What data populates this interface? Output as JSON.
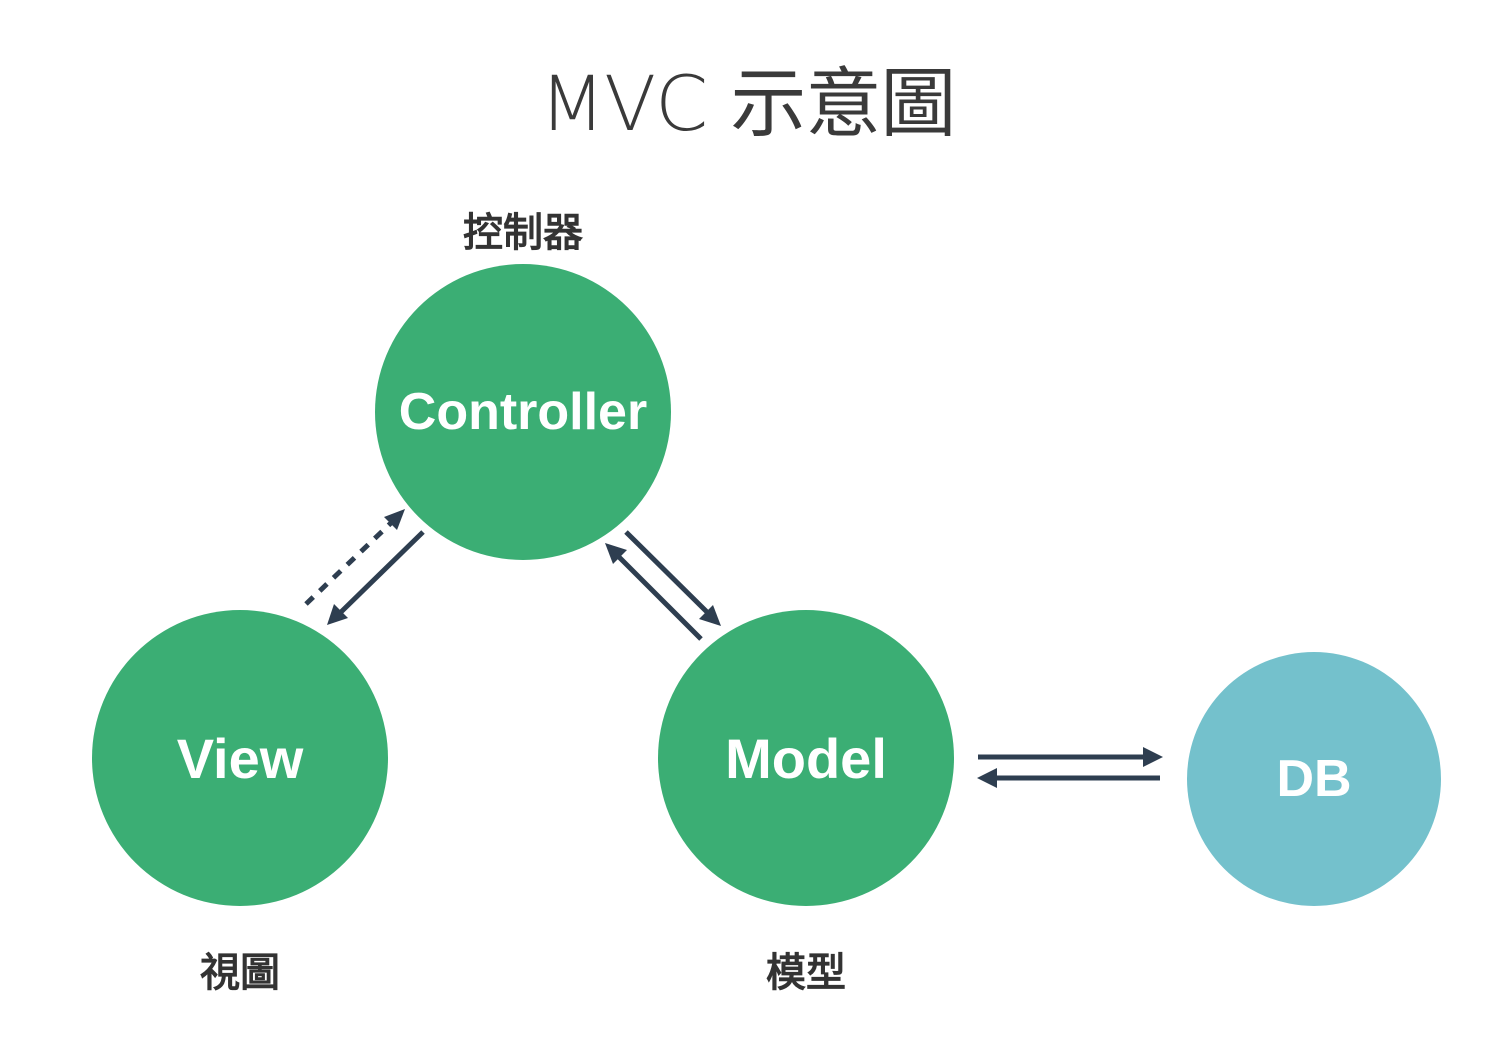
{
  "title": "MVC 示意圖",
  "nodes": {
    "controller": {
      "label": "Controller",
      "caption": "控制器",
      "color": "#3bae74"
    },
    "view": {
      "label": "View",
      "caption": "視圖",
      "color": "#3bae74"
    },
    "model": {
      "label": "Model",
      "caption": "模型",
      "color": "#3bae74"
    },
    "db": {
      "label": "DB",
      "color": "#74c1cc"
    }
  },
  "edges": [
    {
      "from": "view",
      "to": "controller",
      "style": "dashed"
    },
    {
      "from": "controller",
      "to": "view",
      "style": "solid"
    },
    {
      "from": "controller",
      "to": "model",
      "style": "solid"
    },
    {
      "from": "model",
      "to": "controller",
      "style": "solid"
    },
    {
      "from": "model",
      "to": "db",
      "style": "solid"
    },
    {
      "from": "db",
      "to": "model",
      "style": "solid"
    }
  ],
  "arrow_color": "#2e3e50"
}
